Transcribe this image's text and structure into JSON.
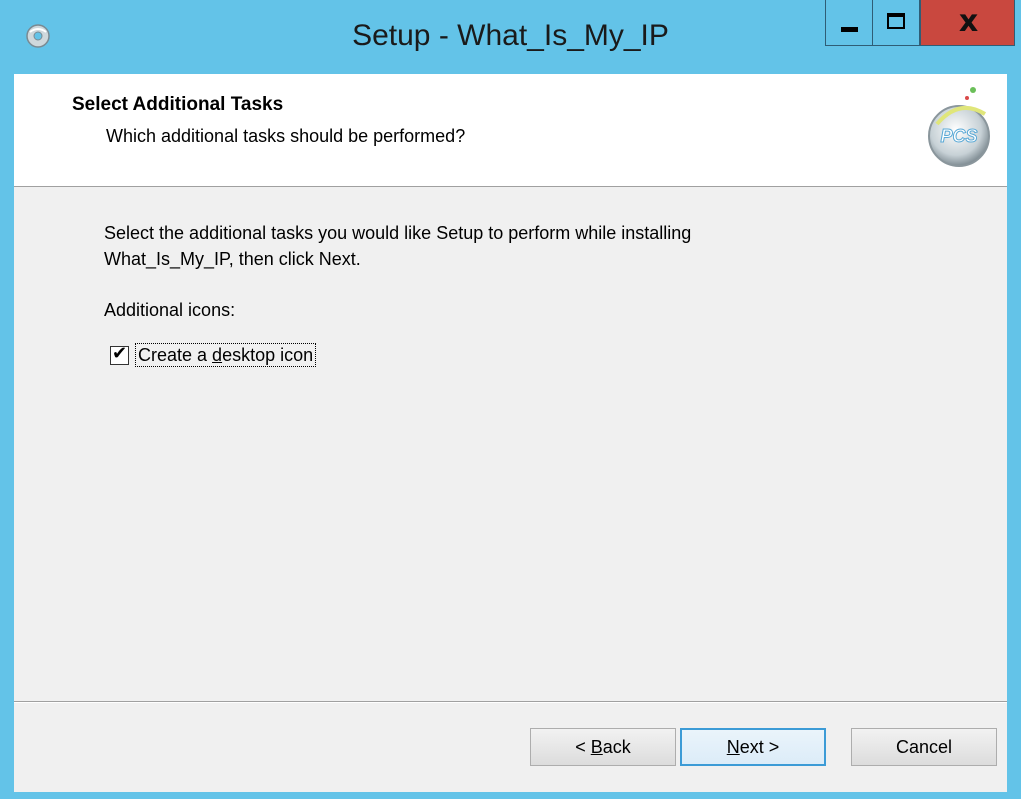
{
  "window": {
    "title": "Setup - What_Is_My_IP",
    "controls": {
      "close_glyph": "x"
    }
  },
  "header": {
    "title": "Select Additional Tasks",
    "subtitle": "Which additional tasks should be performed?",
    "logo_text": "PCS"
  },
  "body": {
    "instruction_line1": "Select the additional tasks you would like Setup to perform while installing",
    "instruction_line2": "What_Is_My_IP, then click Next.",
    "section_label": "Additional icons:",
    "tasks": [
      {
        "label_pre": "Create a ",
        "label_accel": "d",
        "label_post": "esktop icon",
        "checked": true
      }
    ]
  },
  "footer": {
    "back_pre": "< ",
    "back_accel": "B",
    "back_post": "ack",
    "next_accel": "N",
    "next_post": "ext >",
    "cancel_label": "Cancel"
  },
  "colors": {
    "titlebar": "#63c3e8",
    "close_button": "#c9483f",
    "client_bg": "#f0f0f0",
    "header_bg": "#ffffff",
    "default_button_border": "#3c9bd6"
  },
  "icons": {
    "app": "setup-disc-icon",
    "minimize": "minimize-icon",
    "maximize": "maximize-icon",
    "close": "close-icon",
    "logo": "pcs-logo-icon",
    "check": "checkmark-icon"
  }
}
